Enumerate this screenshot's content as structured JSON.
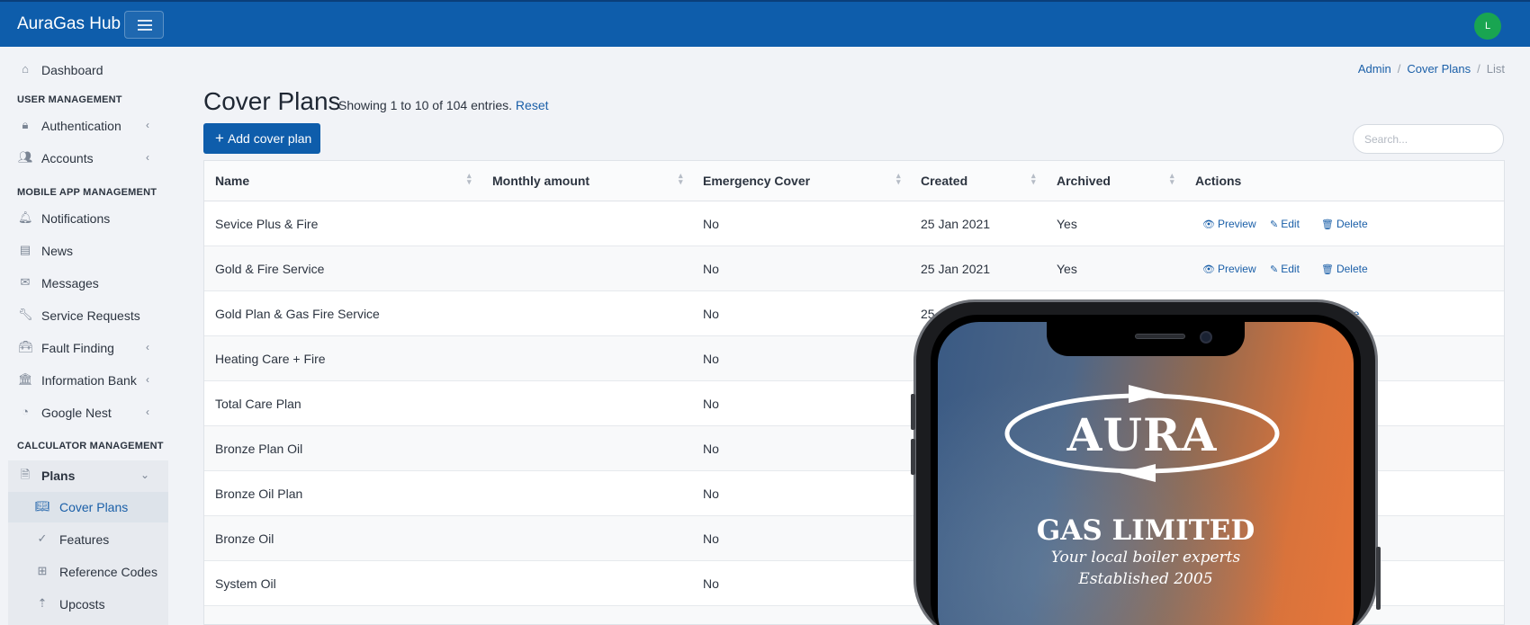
{
  "app": {
    "brand": "AuraGas Hub",
    "user_initial": "L"
  },
  "sidebar": {
    "dashboard": "Dashboard",
    "sections": {
      "user_management": "USER MANAGEMENT",
      "mobile_app_management": "MOBILE APP MANAGEMENT",
      "calculator_management": "CALCULATOR MANAGEMENT"
    },
    "items": {
      "authentication": "Authentication",
      "accounts": "Accounts",
      "notifications": "Notifications",
      "news": "News",
      "messages": "Messages",
      "service_requests": "Service Requests",
      "fault_finding": "Fault Finding",
      "information_bank": "Information Bank",
      "google_nest": "Google Nest",
      "plans": "Plans",
      "cover_plans": "Cover Plans",
      "features": "Features",
      "reference_codes": "Reference Codes",
      "upcosts": "Upcosts"
    }
  },
  "breadcrumb": {
    "admin": "Admin",
    "cover_plans": "Cover Plans",
    "current": "List"
  },
  "page": {
    "title": "Cover Plans",
    "entries": "Showing 1 to 10 of 104 entries.",
    "reset": "Reset",
    "add_button": "Add cover plan",
    "search_placeholder": "Search..."
  },
  "table": {
    "headers": {
      "name": "Name",
      "monthly": "Monthly amount",
      "emergency": "Emergency Cover",
      "created": "Created",
      "archived": "Archived",
      "actions": "Actions"
    },
    "actions": {
      "preview": "Preview",
      "edit": "Edit",
      "delete": "Delete"
    },
    "rows": [
      {
        "name": "Sevice Plus & Fire",
        "emergency": "No",
        "created": "25 Jan 2021",
        "archived": "Yes"
      },
      {
        "name": "Gold & Fire Service",
        "emergency": "No",
        "created": "25 Jan 2021",
        "archived": "Yes"
      },
      {
        "name": "Gold Plan & Gas Fire Service",
        "emergency": "No",
        "created": "25 J",
        "archived": ""
      },
      {
        "name": "Heating Care + Fire",
        "emergency": "No",
        "created": "",
        "archived": ""
      },
      {
        "name": "Total Care Plan",
        "emergency": "No",
        "created": "",
        "archived": ""
      },
      {
        "name": "Bronze Plan Oil",
        "emergency": "No",
        "created": "",
        "archived": ""
      },
      {
        "name": "Bronze Oil Plan",
        "emergency": "No",
        "created": "",
        "archived": ""
      },
      {
        "name": "Bronze Oil",
        "emergency": "No",
        "created": "",
        "archived": ""
      },
      {
        "name": "System Oil",
        "emergency": "No",
        "created": "",
        "archived": ""
      },
      {
        "name": "",
        "emergency": "",
        "created": "",
        "archived": ""
      }
    ],
    "row3_partial_action": "lete"
  },
  "phone": {
    "logo": "AURA",
    "company": "GAS LIMITED",
    "tagline1": "Your local boiler experts",
    "tagline2": "Established 2005"
  },
  "colors": {
    "primary": "#0e5dab",
    "avatar": "#19a551",
    "link": "#1a5fa8"
  }
}
